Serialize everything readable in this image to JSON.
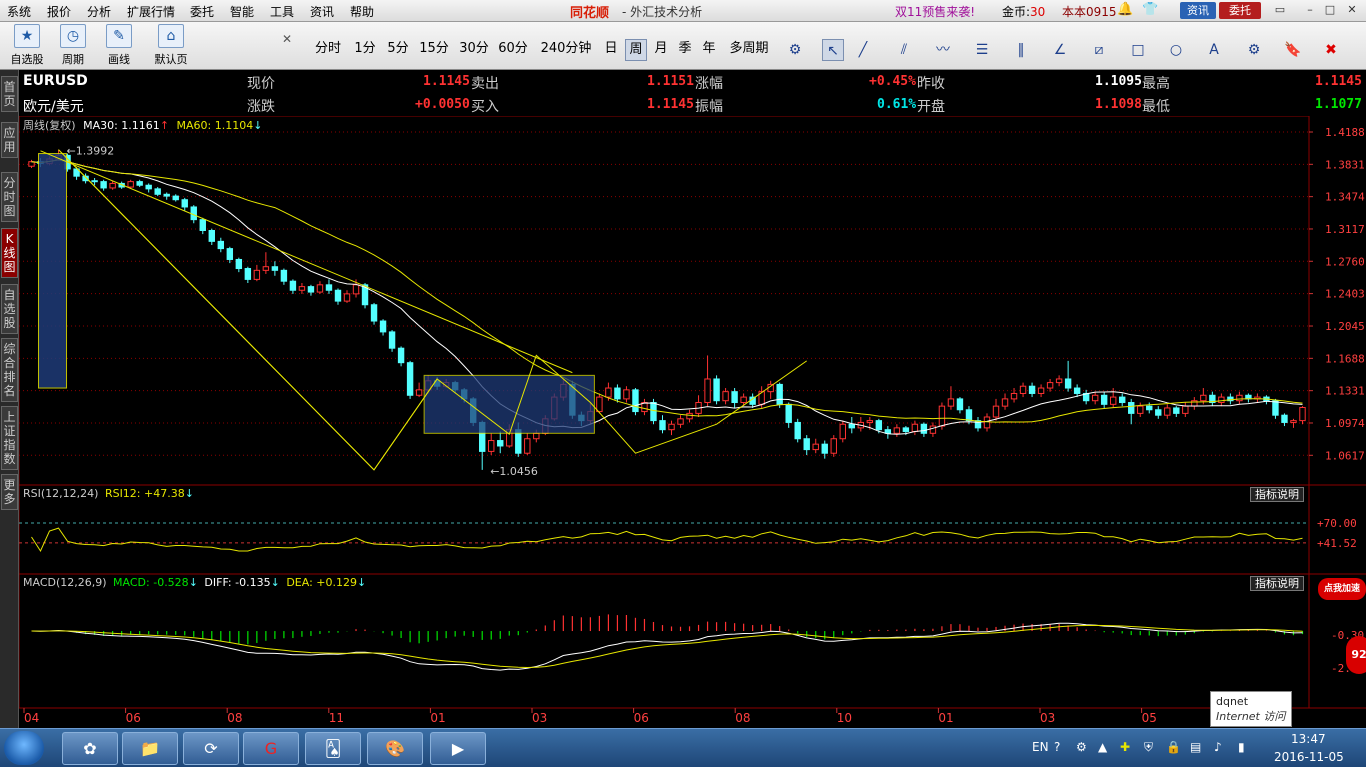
{
  "menu": [
    "系统",
    "报价",
    "分析",
    "扩展行情",
    "委托",
    "智能",
    "工具",
    "资讯",
    "帮助"
  ],
  "brand": "同花顺",
  "app_title": "- 外汇技术分析",
  "promo": "双11预售来袭!",
  "coins_label": "金币:",
  "coins_value": "30",
  "user": "本本0915",
  "btn_news": "资讯",
  "btn_trade": "委托",
  "toolbar_big": [
    {
      "icon": "★",
      "label": "自选股"
    },
    {
      "icon": "◷",
      "label": "周期"
    },
    {
      "icon": "✎",
      "label": "画线"
    },
    {
      "icon": "⌂",
      "label": "默认页"
    }
  ],
  "periods": [
    "分时",
    "1分",
    "5分",
    "15分",
    "30分",
    "60分",
    "240分钟",
    "日",
    "周",
    "月",
    "季",
    "年",
    "多周期"
  ],
  "active_period": "周",
  "side_tabs": [
    "首页",
    "应用",
    "分时图",
    "K线图",
    "自选股",
    "综合排名",
    "上证指数",
    "更多"
  ],
  "quote": {
    "symbol": "EURUSD",
    "name": "欧元/美元",
    "now_label": "现价",
    "now": "1.1145",
    "chg_label": "涨跌",
    "chg": "+0.0050",
    "sell_label": "卖出",
    "sell": "1.1151",
    "buy_label": "买入",
    "buy": "1.1145",
    "pct_label": "涨幅",
    "pct": "+0.45%",
    "amp_label": "振幅",
    "amp": "0.61%",
    "prevclose_label": "昨收",
    "prevclose": "1.1095",
    "open_label": "开盘",
    "open": "1.1098",
    "high_label": "最高",
    "high": "1.1145",
    "low_label": "最低",
    "low": "1.1077"
  },
  "legend_main": {
    "cycle": "周线(复权)",
    "ma30": "MA30: 1.1161",
    "ma60": "MA60: 1.1104"
  },
  "legend_rsi": {
    "text": "RSI(12,12,24)",
    "val": "RSI12: +47.38"
  },
  "legend_macd": {
    "title": "MACD(12,26,9)",
    "macd": "MACD: -0.528",
    "diff": "DIFF: -0.135",
    "dea": "DEA: +0.129"
  },
  "help_label": "指标说明",
  "tooltip": {
    "line1": "dqnet",
    "line2": "Internet 访问"
  },
  "promo_badge": "点我加速",
  "promo_circle": "92",
  "clock_time": "13:47",
  "clock_date": "2016-11-05",
  "tray_lang": "EN",
  "colors": {
    "up": "#ff3232",
    "down": "#54ffff",
    "ma30": "#ffffff",
    "ma60": "#e6e600",
    "grid": "#8b0000"
  },
  "chart_data": {
    "type": "candlestick",
    "yticks": [
      1.4188,
      1.3831,
      1.3474,
      1.3117,
      1.276,
      1.2403,
      1.2045,
      1.1688,
      1.1331,
      1.0974,
      1.0617
    ],
    "ylim": [
      1.03,
      1.4188
    ],
    "xticks": [
      "04",
      "06",
      "08",
      "11",
      "01",
      "03",
      "06",
      "08",
      "10",
      "01",
      "03",
      "05",
      "07"
    ],
    "annotations": {
      "high": "1.3992",
      "low": "1.0456"
    },
    "rsi_ticks": [
      "+70.00",
      "+41.52"
    ],
    "macd_ticks": [
      "-0.30",
      "-2.87"
    ],
    "rsi_range": [
      0,
      100
    ],
    "macd_range": [
      -6.0,
      3.2
    ],
    "candles": [
      [
        1.381,
        1.386,
        1.379,
        1.388
      ],
      [
        1.386,
        1.384,
        1.38,
        1.39
      ],
      [
        1.384,
        1.389,
        1.382,
        1.392
      ],
      [
        1.389,
        1.393,
        1.387,
        1.3992
      ],
      [
        1.393,
        1.378,
        1.375,
        1.395
      ],
      [
        1.378,
        1.37,
        1.366,
        1.38
      ],
      [
        1.37,
        1.365,
        1.362,
        1.373
      ],
      [
        1.365,
        1.364,
        1.36,
        1.368
      ],
      [
        1.364,
        1.357,
        1.354,
        1.366
      ],
      [
        1.357,
        1.362,
        1.355,
        1.365
      ],
      [
        1.362,
        1.358,
        1.356,
        1.364
      ],
      [
        1.358,
        1.364,
        1.356,
        1.366
      ],
      [
        1.364,
        1.36,
        1.358,
        1.366
      ],
      [
        1.36,
        1.356,
        1.352,
        1.362
      ],
      [
        1.356,
        1.35,
        1.348,
        1.358
      ],
      [
        1.35,
        1.348,
        1.344,
        1.352
      ],
      [
        1.348,
        1.344,
        1.342,
        1.35
      ],
      [
        1.344,
        1.336,
        1.332,
        1.346
      ],
      [
        1.336,
        1.322,
        1.318,
        1.338
      ],
      [
        1.322,
        1.31,
        1.306,
        1.324
      ],
      [
        1.31,
        1.298,
        1.294,
        1.312
      ],
      [
        1.298,
        1.29,
        1.286,
        1.302
      ],
      [
        1.29,
        1.278,
        1.274,
        1.292
      ],
      [
        1.278,
        1.268,
        1.264,
        1.28
      ],
      [
        1.268,
        1.256,
        1.252,
        1.27
      ],
      [
        1.256,
        1.266,
        1.254,
        1.272
      ],
      [
        1.266,
        1.27,
        1.262,
        1.286
      ],
      [
        1.27,
        1.266,
        1.26,
        1.276
      ],
      [
        1.266,
        1.254,
        1.25,
        1.268
      ],
      [
        1.254,
        1.244,
        1.24,
        1.256
      ],
      [
        1.244,
        1.248,
        1.24,
        1.252
      ],
      [
        1.248,
        1.242,
        1.238,
        1.25
      ],
      [
        1.242,
        1.25,
        1.24,
        1.254
      ],
      [
        1.25,
        1.244,
        1.24,
        1.256
      ],
      [
        1.244,
        1.232,
        1.228,
        1.246
      ],
      [
        1.232,
        1.24,
        1.23,
        1.244
      ],
      [
        1.24,
        1.25,
        1.236,
        1.256
      ],
      [
        1.25,
        1.228,
        1.224,
        1.252
      ],
      [
        1.228,
        1.21,
        1.206,
        1.23
      ],
      [
        1.21,
        1.198,
        1.194,
        1.212
      ],
      [
        1.198,
        1.18,
        1.176,
        1.2
      ],
      [
        1.18,
        1.164,
        1.16,
        1.182
      ],
      [
        1.164,
        1.128,
        1.124,
        1.166
      ],
      [
        1.128,
        1.134,
        1.126,
        1.142
      ],
      [
        1.134,
        1.144,
        1.13,
        1.15
      ],
      [
        1.144,
        1.138,
        1.134,
        1.148
      ],
      [
        1.138,
        1.142,
        1.136,
        1.146
      ],
      [
        1.142,
        1.134,
        1.13,
        1.144
      ],
      [
        1.134,
        1.124,
        1.12,
        1.136
      ],
      [
        1.124,
        1.098,
        1.094,
        1.126
      ],
      [
        1.098,
        1.066,
        1.0456,
        1.1
      ],
      [
        1.066,
        1.078,
        1.062,
        1.086
      ],
      [
        1.078,
        1.072,
        1.064,
        1.088
      ],
      [
        1.072,
        1.09,
        1.07,
        1.096
      ],
      [
        1.09,
        1.064,
        1.06,
        1.098
      ],
      [
        1.064,
        1.08,
        1.062,
        1.086
      ],
      [
        1.08,
        1.086,
        1.076,
        1.09
      ],
      [
        1.086,
        1.102,
        1.084,
        1.106
      ],
      [
        1.102,
        1.126,
        1.1,
        1.13
      ],
      [
        1.126,
        1.14,
        1.122,
        1.146
      ],
      [
        1.14,
        1.106,
        1.102,
        1.144
      ],
      [
        1.106,
        1.1,
        1.094,
        1.11
      ],
      [
        1.1,
        1.11,
        1.096,
        1.12
      ],
      [
        1.11,
        1.126,
        1.108,
        1.13
      ],
      [
        1.126,
        1.136,
        1.122,
        1.142
      ],
      [
        1.136,
        1.124,
        1.12,
        1.14
      ],
      [
        1.124,
        1.134,
        1.12,
        1.138
      ],
      [
        1.134,
        1.11,
        1.106,
        1.136
      ],
      [
        1.11,
        1.12,
        1.106,
        1.124
      ],
      [
        1.12,
        1.1,
        1.096,
        1.124
      ],
      [
        1.1,
        1.09,
        1.086,
        1.106
      ],
      [
        1.09,
        1.096,
        1.084,
        1.1
      ],
      [
        1.096,
        1.102,
        1.092,
        1.106
      ],
      [
        1.102,
        1.108,
        1.098,
        1.112
      ],
      [
        1.108,
        1.12,
        1.104,
        1.128
      ],
      [
        1.12,
        1.146,
        1.116,
        1.172
      ],
      [
        1.146,
        1.122,
        1.118,
        1.15
      ],
      [
        1.122,
        1.132,
        1.118,
        1.136
      ],
      [
        1.132,
        1.12,
        1.114,
        1.136
      ],
      [
        1.12,
        1.126,
        1.116,
        1.13
      ],
      [
        1.126,
        1.118,
        1.114,
        1.13
      ],
      [
        1.118,
        1.132,
        1.114,
        1.138
      ],
      [
        1.132,
        1.14,
        1.124,
        1.144
      ],
      [
        1.14,
        1.118,
        1.114,
        1.142
      ],
      [
        1.118,
        1.098,
        1.092,
        1.12
      ],
      [
        1.098,
        1.08,
        1.076,
        1.102
      ],
      [
        1.08,
        1.068,
        1.062,
        1.084
      ],
      [
        1.068,
        1.074,
        1.064,
        1.08
      ],
      [
        1.074,
        1.064,
        1.058,
        1.078
      ],
      [
        1.064,
        1.08,
        1.06,
        1.084
      ],
      [
        1.08,
        1.096,
        1.076,
        1.1
      ],
      [
        1.096,
        1.092,
        1.086,
        1.104
      ],
      [
        1.092,
        1.098,
        1.088,
        1.104
      ],
      [
        1.098,
        1.1,
        1.09,
        1.104
      ],
      [
        1.1,
        1.09,
        1.086,
        1.102
      ],
      [
        1.09,
        1.086,
        1.08,
        1.094
      ],
      [
        1.086,
        1.092,
        1.082,
        1.096
      ],
      [
        1.092,
        1.088,
        1.084,
        1.094
      ],
      [
        1.088,
        1.096,
        1.084,
        1.1
      ],
      [
        1.096,
        1.086,
        1.082,
        1.098
      ],
      [
        1.086,
        1.094,
        1.082,
        1.098
      ],
      [
        1.094,
        1.116,
        1.09,
        1.12
      ],
      [
        1.116,
        1.124,
        1.112,
        1.138
      ],
      [
        1.124,
        1.112,
        1.108,
        1.126
      ],
      [
        1.112,
        1.1,
        1.096,
        1.116
      ],
      [
        1.1,
        1.092,
        1.088,
        1.104
      ],
      [
        1.092,
        1.104,
        1.088,
        1.108
      ],
      [
        1.104,
        1.116,
        1.1,
        1.124
      ],
      [
        1.116,
        1.124,
        1.112,
        1.13
      ],
      [
        1.124,
        1.13,
        1.12,
        1.136
      ],
      [
        1.13,
        1.138,
        1.126,
        1.142
      ],
      [
        1.138,
        1.13,
        1.126,
        1.142
      ],
      [
        1.13,
        1.136,
        1.126,
        1.14
      ],
      [
        1.136,
        1.142,
        1.132,
        1.146
      ],
      [
        1.142,
        1.146,
        1.138,
        1.15
      ],
      [
        1.146,
        1.136,
        1.132,
        1.166
      ],
      [
        1.136,
        1.13,
        1.126,
        1.14
      ],
      [
        1.13,
        1.122,
        1.118,
        1.134
      ],
      [
        1.122,
        1.128,
        1.118,
        1.132
      ],
      [
        1.128,
        1.118,
        1.114,
        1.132
      ],
      [
        1.118,
        1.126,
        1.114,
        1.136
      ],
      [
        1.126,
        1.12,
        1.116,
        1.13
      ],
      [
        1.12,
        1.108,
        1.096,
        1.124
      ],
      [
        1.108,
        1.116,
        1.104,
        1.12
      ],
      [
        1.116,
        1.112,
        1.108,
        1.12
      ],
      [
        1.112,
        1.106,
        1.102,
        1.116
      ],
      [
        1.106,
        1.114,
        1.102,
        1.118
      ],
      [
        1.114,
        1.108,
        1.104,
        1.116
      ],
      [
        1.108,
        1.116,
        1.104,
        1.12
      ],
      [
        1.116,
        1.122,
        1.112,
        1.126
      ],
      [
        1.122,
        1.128,
        1.118,
        1.136
      ],
      [
        1.128,
        1.12,
        1.116,
        1.132
      ],
      [
        1.12,
        1.126,
        1.116,
        1.13
      ],
      [
        1.126,
        1.122,
        1.118,
        1.13
      ],
      [
        1.122,
        1.128,
        1.118,
        1.132
      ],
      [
        1.128,
        1.124,
        1.12,
        1.13
      ],
      [
        1.124,
        1.126,
        1.12,
        1.13
      ],
      [
        1.126,
        1.122,
        1.118,
        1.128
      ],
      [
        1.122,
        1.106,
        1.102,
        1.124
      ],
      [
        1.106,
        1.098,
        1.094,
        1.108
      ],
      [
        1.098,
        1.1,
        1.092,
        1.102
      ],
      [
        1.1,
        1.1145,
        1.096,
        1.116
      ]
    ]
  }
}
